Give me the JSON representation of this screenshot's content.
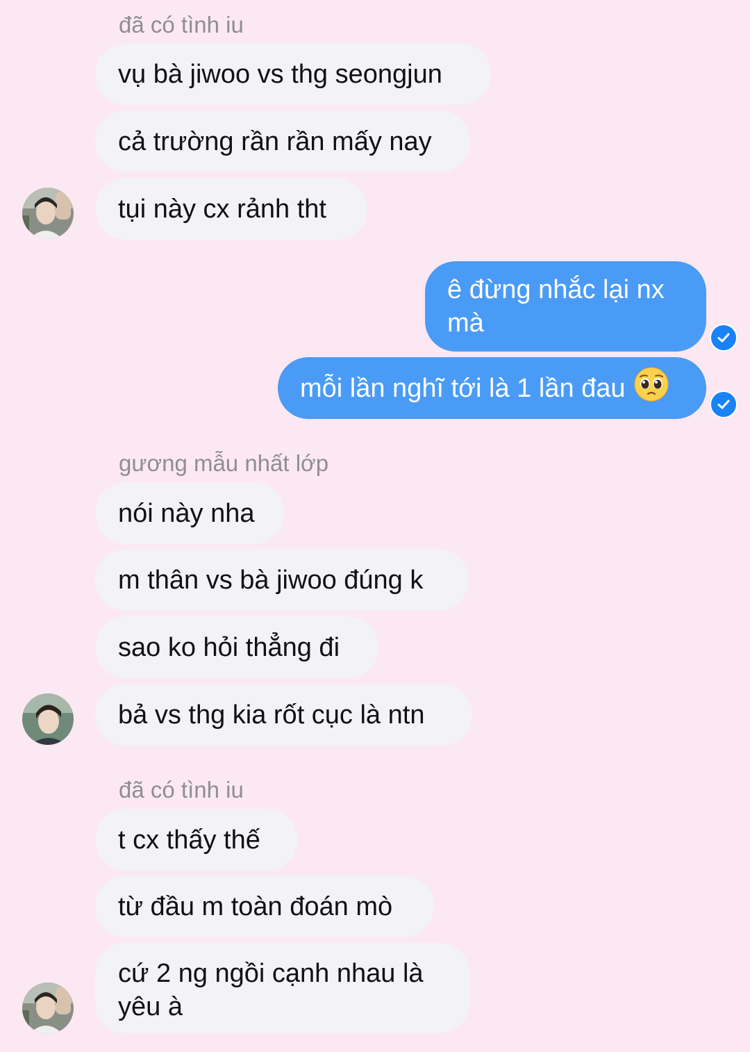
{
  "conversation": {
    "groups": [
      {
        "sender": "đã có tình iu",
        "messages": [
          "vụ bà jiwoo vs thg seongjun",
          "cả trường rần rần mấy nay",
          "tụi này cx rảnh tht"
        ]
      },
      {
        "sender": "",
        "messages": [
          "ê đừng nhắc lại nx mà",
          "mỗi lần nghĩ tới là 1 lần đau"
        ]
      },
      {
        "sender": "gương mẫu nhất lớp",
        "messages": [
          "nói này nha",
          "m thân vs bà jiwoo đúng k",
          "sao ko hỏi thẳng đi",
          "bả vs thg kia rốt cục là ntn"
        ]
      },
      {
        "sender": "đã có tình iu",
        "messages": [
          "t cx thấy thế",
          "từ đầu m toàn đoán mò",
          "cứ 2 ng ngồi cạnh nhau là yêu à"
        ]
      }
    ]
  },
  "icons": {
    "read_receipt": "checkmark-circle-icon",
    "emoji": "pleading-face-emoji"
  },
  "colors": {
    "background": "#fce8f3",
    "incoming_bubble": "#f2f2f7",
    "outgoing_bubble": "#4a9bf5",
    "read_check": "#1a82f7"
  }
}
